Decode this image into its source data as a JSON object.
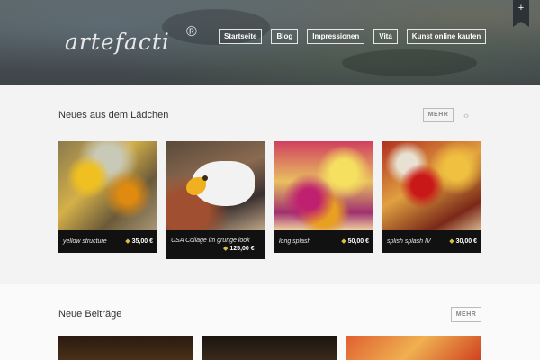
{
  "header": {
    "logo": "artefacti",
    "logo_mark": "®",
    "nav": [
      "Startseite",
      "Blog",
      "Impressionen",
      "Vita",
      "Kunst online kaufen"
    ],
    "ribbon_icon": "plus-icon",
    "ribbon_glyph": "+"
  },
  "shop": {
    "title": "Neues aus dem Lädchen",
    "more": "MEHR",
    "prev_icon": "chevron-left-icon",
    "next_icon": "chevron-right-icon",
    "prev_glyph": "‹",
    "next_glyph": "›",
    "products": [
      {
        "name": "yellow structure",
        "price": "35,00 €"
      },
      {
        "name": "USA Collage im grunge look",
        "price": "125,00 €"
      },
      {
        "name": "long splash",
        "price": "50,00 €"
      },
      {
        "name": "splish splash IV",
        "price": "30,00 €"
      }
    ],
    "price_tag_icon": "price-tag-icon",
    "price_tag_glyph": "◆"
  },
  "posts": {
    "title": "Neue Beiträge",
    "more": "MEHR"
  },
  "colors": {
    "header_bg": "#4a5258",
    "card_bg": "#111111",
    "price_tag": "#d8c14a"
  }
}
